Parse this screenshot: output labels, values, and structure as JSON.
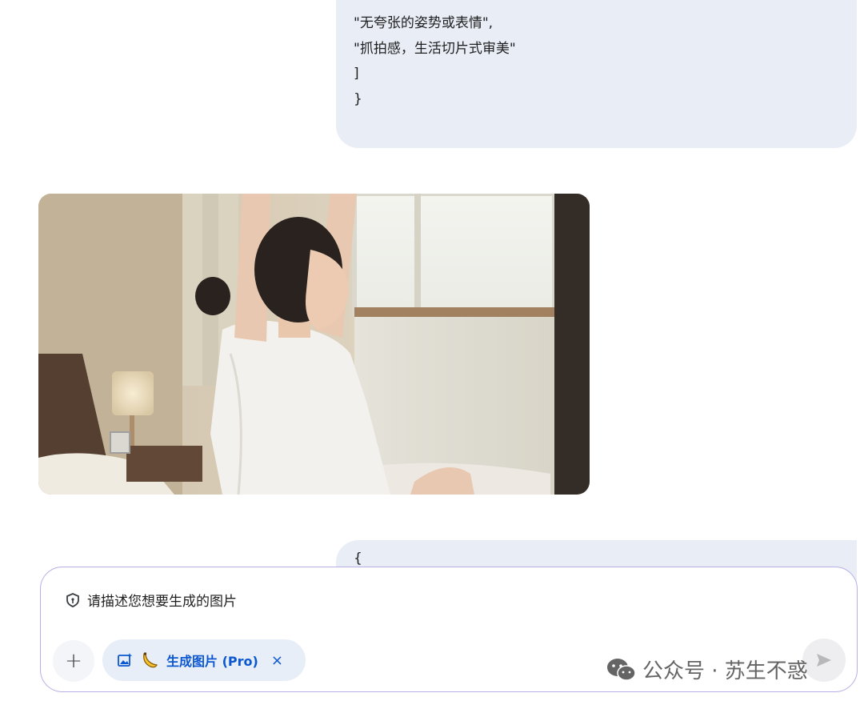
{
  "conversation": {
    "top_bubble_lines": [
      "\"无夸张的姿势或表情\",",
      "\"抓拍感，生活切片式审美\"",
      "]",
      "}"
    ],
    "bottom_bubble_first_line": "{"
  },
  "generated_image": {
    "subject": "woman stretching on bed by window"
  },
  "composer": {
    "placeholder": "请描述您想要生成的图片",
    "tool_chip_label": "生成图片 (Pro)",
    "tool_chip_close": "×",
    "plus_label": "+"
  },
  "watermark": {
    "text": "公众号 · 苏生不惑"
  },
  "colors": {
    "bubble_bg": "#e8edf6",
    "accent_blue": "#0b57d0",
    "composer_border": "#b7aee8"
  }
}
